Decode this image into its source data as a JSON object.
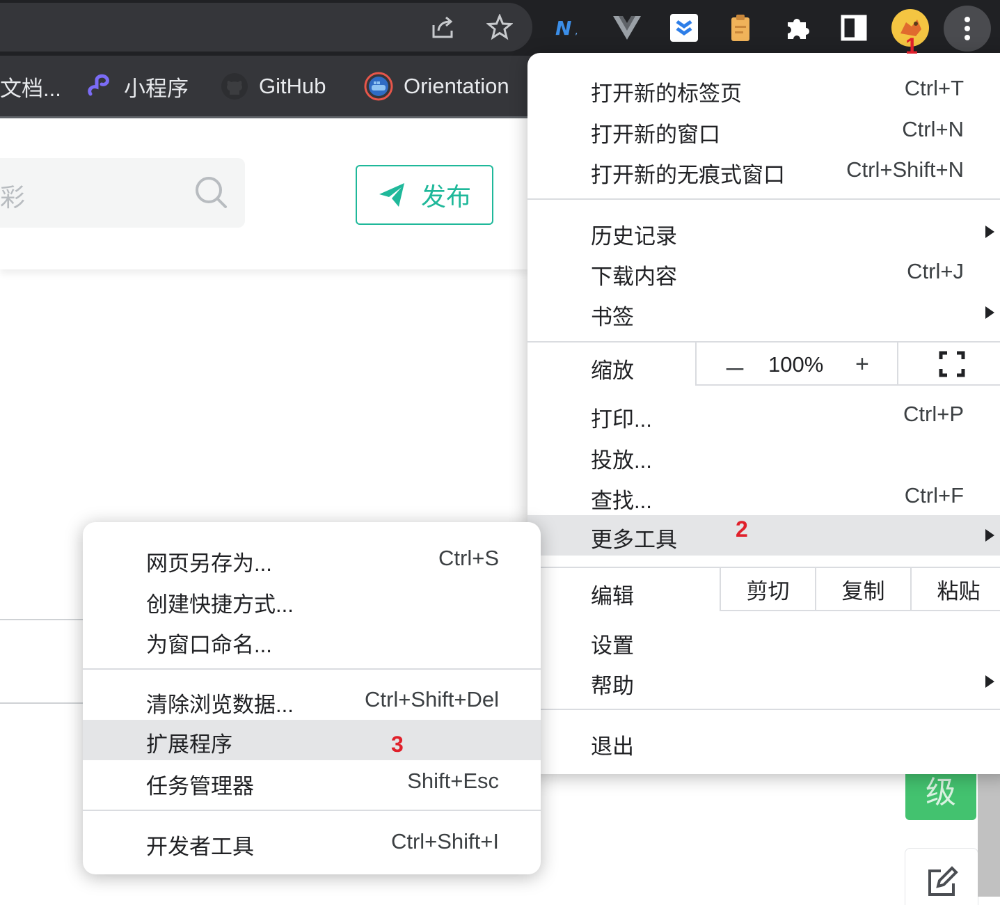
{
  "bookmarks": [
    {
      "label": "文档...",
      "icon": "document-icon"
    },
    {
      "label": "小程序",
      "icon": "mini-program-icon"
    },
    {
      "label": "GitHub",
      "icon": "github-icon"
    },
    {
      "label": "Orientation",
      "icon": "docker-icon"
    }
  ],
  "toolbar": {
    "extensions": [
      "naive-ui-icon",
      "vue-devtools-icon",
      "toolkit-icon",
      "clipboard-icon",
      "puzzle-icon",
      "side-panel-icon",
      "profile-avatar"
    ]
  },
  "page": {
    "search_placeholder": "彩",
    "publish_label": "发布",
    "level_badge": "级"
  },
  "main_menu": {
    "new_tab": {
      "label": "打开新的标签页",
      "shortcut": "Ctrl+T"
    },
    "new_window": {
      "label": "打开新的窗口",
      "shortcut": "Ctrl+N"
    },
    "incognito": {
      "label": "打开新的无痕式窗口",
      "shortcut": "Ctrl+Shift+N"
    },
    "history": {
      "label": "历史记录"
    },
    "downloads": {
      "label": "下载内容",
      "shortcut": "Ctrl+J"
    },
    "bookmarks": {
      "label": "书签"
    },
    "zoom": {
      "label": "缩放",
      "minus": "－",
      "value": "100%",
      "plus": "+"
    },
    "print": {
      "label": "打印...",
      "shortcut": "Ctrl+P"
    },
    "cast": {
      "label": "投放..."
    },
    "find": {
      "label": "查找...",
      "shortcut": "Ctrl+F"
    },
    "more_tools": {
      "label": "更多工具"
    },
    "edit": {
      "label": "编辑",
      "cut": "剪切",
      "copy": "复制",
      "paste": "粘贴"
    },
    "settings": {
      "label": "设置"
    },
    "help": {
      "label": "帮助"
    },
    "exit": {
      "label": "退出"
    }
  },
  "sub_menu": {
    "save_page": {
      "label": "网页另存为...",
      "shortcut": "Ctrl+S"
    },
    "create_shortcut": {
      "label": "创建快捷方式..."
    },
    "name_window": {
      "label": "为窗口命名..."
    },
    "clear_data": {
      "label": "清除浏览数据...",
      "shortcut": "Ctrl+Shift+Del"
    },
    "extensions": {
      "label": "扩展程序"
    },
    "task_manager": {
      "label": "任务管理器",
      "shortcut": "Shift+Esc"
    },
    "devtools": {
      "label": "开发者工具",
      "shortcut": "Ctrl+Shift+I"
    }
  },
  "annotations": {
    "step1": "1",
    "step2": "2",
    "step3": "3"
  },
  "colors": {
    "accent": "#1fb89a",
    "marker": "#e0202b",
    "highlight": "#e4e5e7",
    "chrome_dark": "#202124"
  }
}
